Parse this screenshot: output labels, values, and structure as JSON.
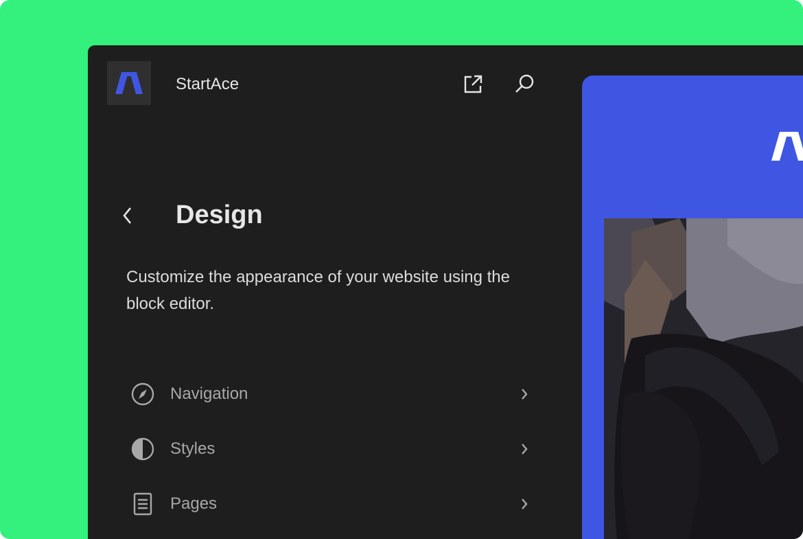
{
  "site": {
    "title": "StartAce",
    "logo": "startace-logo"
  },
  "header": {
    "open_icon": "external-link-icon",
    "search_icon": "search-icon"
  },
  "panel": {
    "back_icon": "chevron-left-icon",
    "title": "Design",
    "description": "Customize the appearance of your website using the block editor."
  },
  "menu": {
    "items": [
      {
        "label": "Navigation",
        "icon": "compass-icon"
      },
      {
        "label": "Styles",
        "icon": "half-circle-icon"
      },
      {
        "label": "Pages",
        "icon": "page-icon"
      }
    ]
  },
  "colors": {
    "background": "#33f17c",
    "window": "#1e1e1e",
    "accent": "#3f56e3"
  }
}
